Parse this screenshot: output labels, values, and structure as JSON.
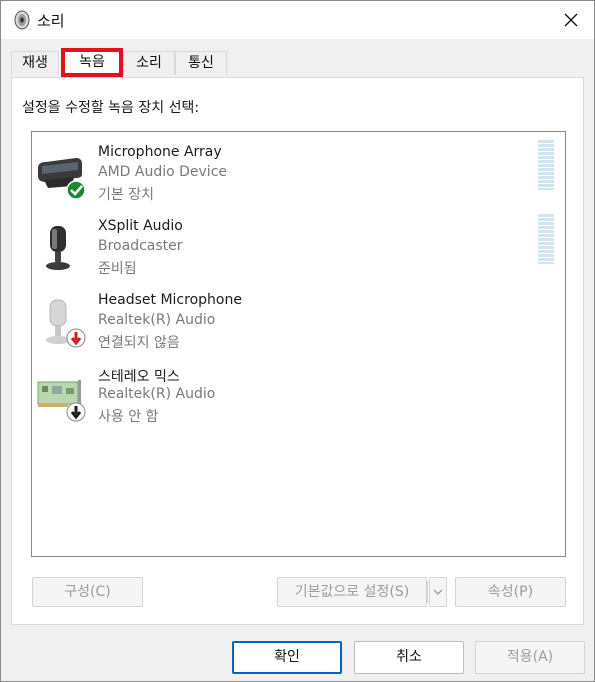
{
  "window": {
    "title": "소리",
    "close_icon": "close-icon",
    "app_icon": "speaker-icon"
  },
  "tabs": [
    {
      "label": "재생",
      "selected": false
    },
    {
      "label": "녹음",
      "selected": true
    },
    {
      "label": "소리",
      "selected": false
    },
    {
      "label": "통신",
      "selected": false
    }
  ],
  "instruction": "설정을 수정할 녹음 장치 선택:",
  "devices": [
    {
      "name": "Microphone Array",
      "driver": "AMD Audio Device",
      "status": "기본 장치",
      "icon": "microphone-array-icon",
      "badge": "default-check-icon",
      "has_meter": true
    },
    {
      "name": "XSplit Audio",
      "driver": "Broadcaster",
      "status": "준비됨",
      "icon": "microphone-icon",
      "badge": "",
      "has_meter": true
    },
    {
      "name": "Headset Microphone",
      "driver": "Realtek(R) Audio",
      "status": "연결되지 않음",
      "icon": "headset-microphone-icon",
      "badge": "unplugged-arrow-icon",
      "has_meter": false
    },
    {
      "name": "스테레오 믹스",
      "driver": "Realtek(R) Audio",
      "status": "사용 안 함",
      "icon": "sound-card-icon",
      "badge": "disabled-arrow-icon",
      "has_meter": false
    }
  ],
  "buttons": {
    "configure": "구성(C)",
    "set_default": "기본값으로 설정(S)",
    "properties": "속성(P)",
    "ok": "확인",
    "cancel": "취소",
    "apply": "적용(A)"
  },
  "colors": {
    "accent": "#0067c0",
    "highlight_box": "#e6101d",
    "meter": "#cfe4ee",
    "check_badge": "#1a8a2e",
    "unplugged_badge": "#d11a1a"
  }
}
